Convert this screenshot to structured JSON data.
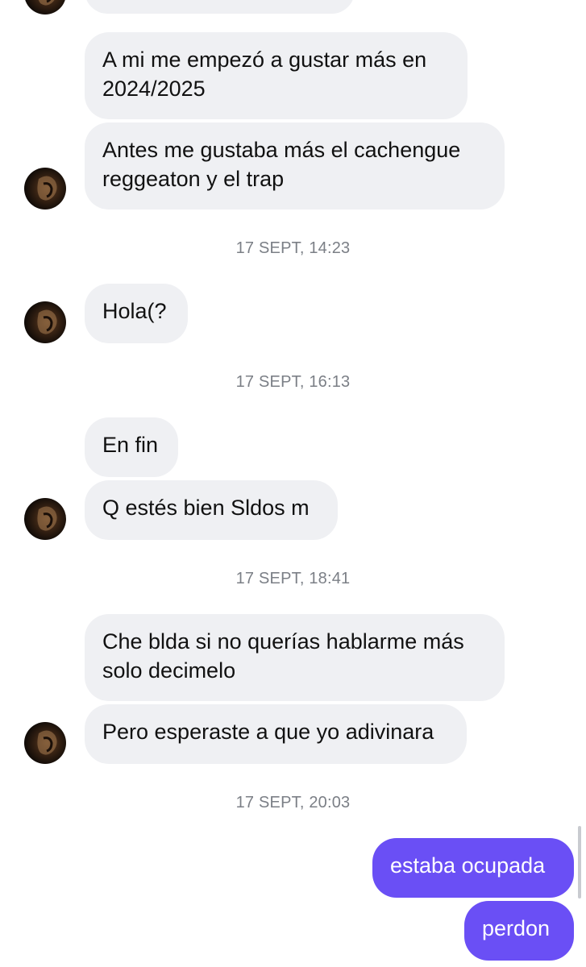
{
  "contact": {
    "avatar_icon": "profile-photo-avatar"
  },
  "colors": {
    "incoming_bubble": "#eff0f3",
    "outgoing_bubble": "#6a4ff5",
    "timestamp": "#7b7f86"
  },
  "messages": {
    "m1": "A mi me empezó a gustar más en",
    "m1b": "2024/2025",
    "m2": "Antes me gustaba más el cachengue",
    "m2b": "reggeaton y el trap",
    "ts1": "17 SEPT, 14:23",
    "m3": "Hola(?",
    "ts2": "17 SEPT, 16:13",
    "m4": "En fin",
    "m5": "Q estés bien Sldos m",
    "ts3": "17 SEPT, 18:41",
    "m6": "Che blda si no querías hablarme más",
    "m6b": "solo decimelo",
    "m7": "Pero esperaste a que yo adivinara",
    "ts4": "17 SEPT, 20:03",
    "m8": "estaba ocupada",
    "m9": "perdon"
  }
}
